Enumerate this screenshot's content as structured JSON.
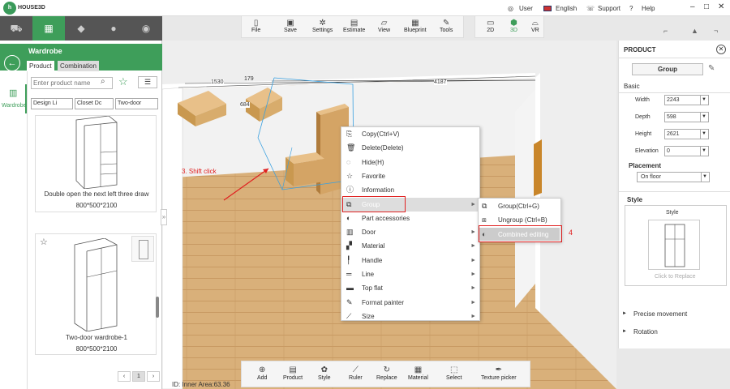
{
  "topbar": {
    "brand": "HOUSE3D",
    "user": "User",
    "language": "English",
    "support": "Support",
    "help": "Help"
  },
  "categories": [
    {
      "icon": "sofa-icon"
    },
    {
      "icon": "wardrobe-icon"
    },
    {
      "icon": "tag-icon"
    },
    {
      "icon": "person-icon"
    },
    {
      "icon": "search-icon"
    }
  ],
  "toolbar": {
    "file": "File",
    "save": "Save",
    "settings": "Settings",
    "estimate": "Estimate",
    "view": "View",
    "blueprint": "Blueprint",
    "tools": "Tools"
  },
  "viewmodes": {
    "v2d": "2D",
    "v3d": "3D",
    "vr": "VR"
  },
  "left": {
    "title": "Wardrobe",
    "tab_product": "Product",
    "tab_combination": "Combination",
    "search_placeholder": "Enter product name",
    "side_label": "Wardrobe",
    "filter1": "Design Li",
    "filter2": "Closet Dc",
    "filter3": "Two-door",
    "item1_name": "Double open the next left three draw",
    "item1_dims": "800*500*2100",
    "item2_name": "Two-door wardrobe-1",
    "item2_dims": "800*500*2100",
    "page": "1"
  },
  "canvas": {
    "dim1": "1530",
    "dim2": "179",
    "dim3": "684",
    "dim4": "4187",
    "annotation": "3. Shift click",
    "step4": "4",
    "footer": "ID:    Inner Area:63.36"
  },
  "context_menu": [
    {
      "label": "Copy(Ctrl+V)",
      "icon": "copy-icon"
    },
    {
      "label": "Delete(Delete)",
      "icon": "trash-icon"
    },
    {
      "label": "Hide(H)",
      "icon": "eye-icon"
    },
    {
      "label": "Favorite",
      "icon": "star-icon"
    },
    {
      "label": "Information",
      "icon": "info-icon"
    },
    {
      "label": "Group",
      "icon": "group-icon"
    },
    {
      "label": "Part accessories",
      "icon": "toggle-icon"
    },
    {
      "label": "Door",
      "icon": "door-icon"
    },
    {
      "label": "Material",
      "icon": "material-icon"
    },
    {
      "label": "Handle",
      "icon": "handle-icon"
    },
    {
      "label": "Line",
      "icon": "line-icon"
    },
    {
      "label": "Top flat",
      "icon": "topflat-icon"
    },
    {
      "label": "Format painter",
      "icon": "brush-icon"
    },
    {
      "label": "Size",
      "icon": "ruler-icon"
    }
  ],
  "submenu": [
    "Group(Ctrl+G)",
    "Ungroup (Ctrl+B)",
    "Combined editing"
  ],
  "product": {
    "title": "PRODUCT",
    "group_label": "Group",
    "basic": "Basic",
    "width_label": "Width",
    "width": "2243",
    "depth_label": "Depth",
    "depth": "598",
    "height_label": "Height",
    "height": "2621",
    "elevation_label": "Elevation",
    "elevation": "0",
    "placement": "Placement",
    "placement_value": "On floor",
    "style": "Style",
    "style_label": "Style",
    "replace": "Click to Replace",
    "precise": "Precise movement",
    "rotation": "Rotation"
  },
  "bottom": {
    "add": "Add",
    "product": "Product",
    "style": "Style",
    "ruler": "Ruler",
    "replace": "Replace",
    "material": "Material",
    "select": "Select",
    "texture": "Texture picker"
  },
  "colors": {
    "green": "#3e9e5a",
    "highlight": "#e02020",
    "wood": "#d9b07a"
  }
}
